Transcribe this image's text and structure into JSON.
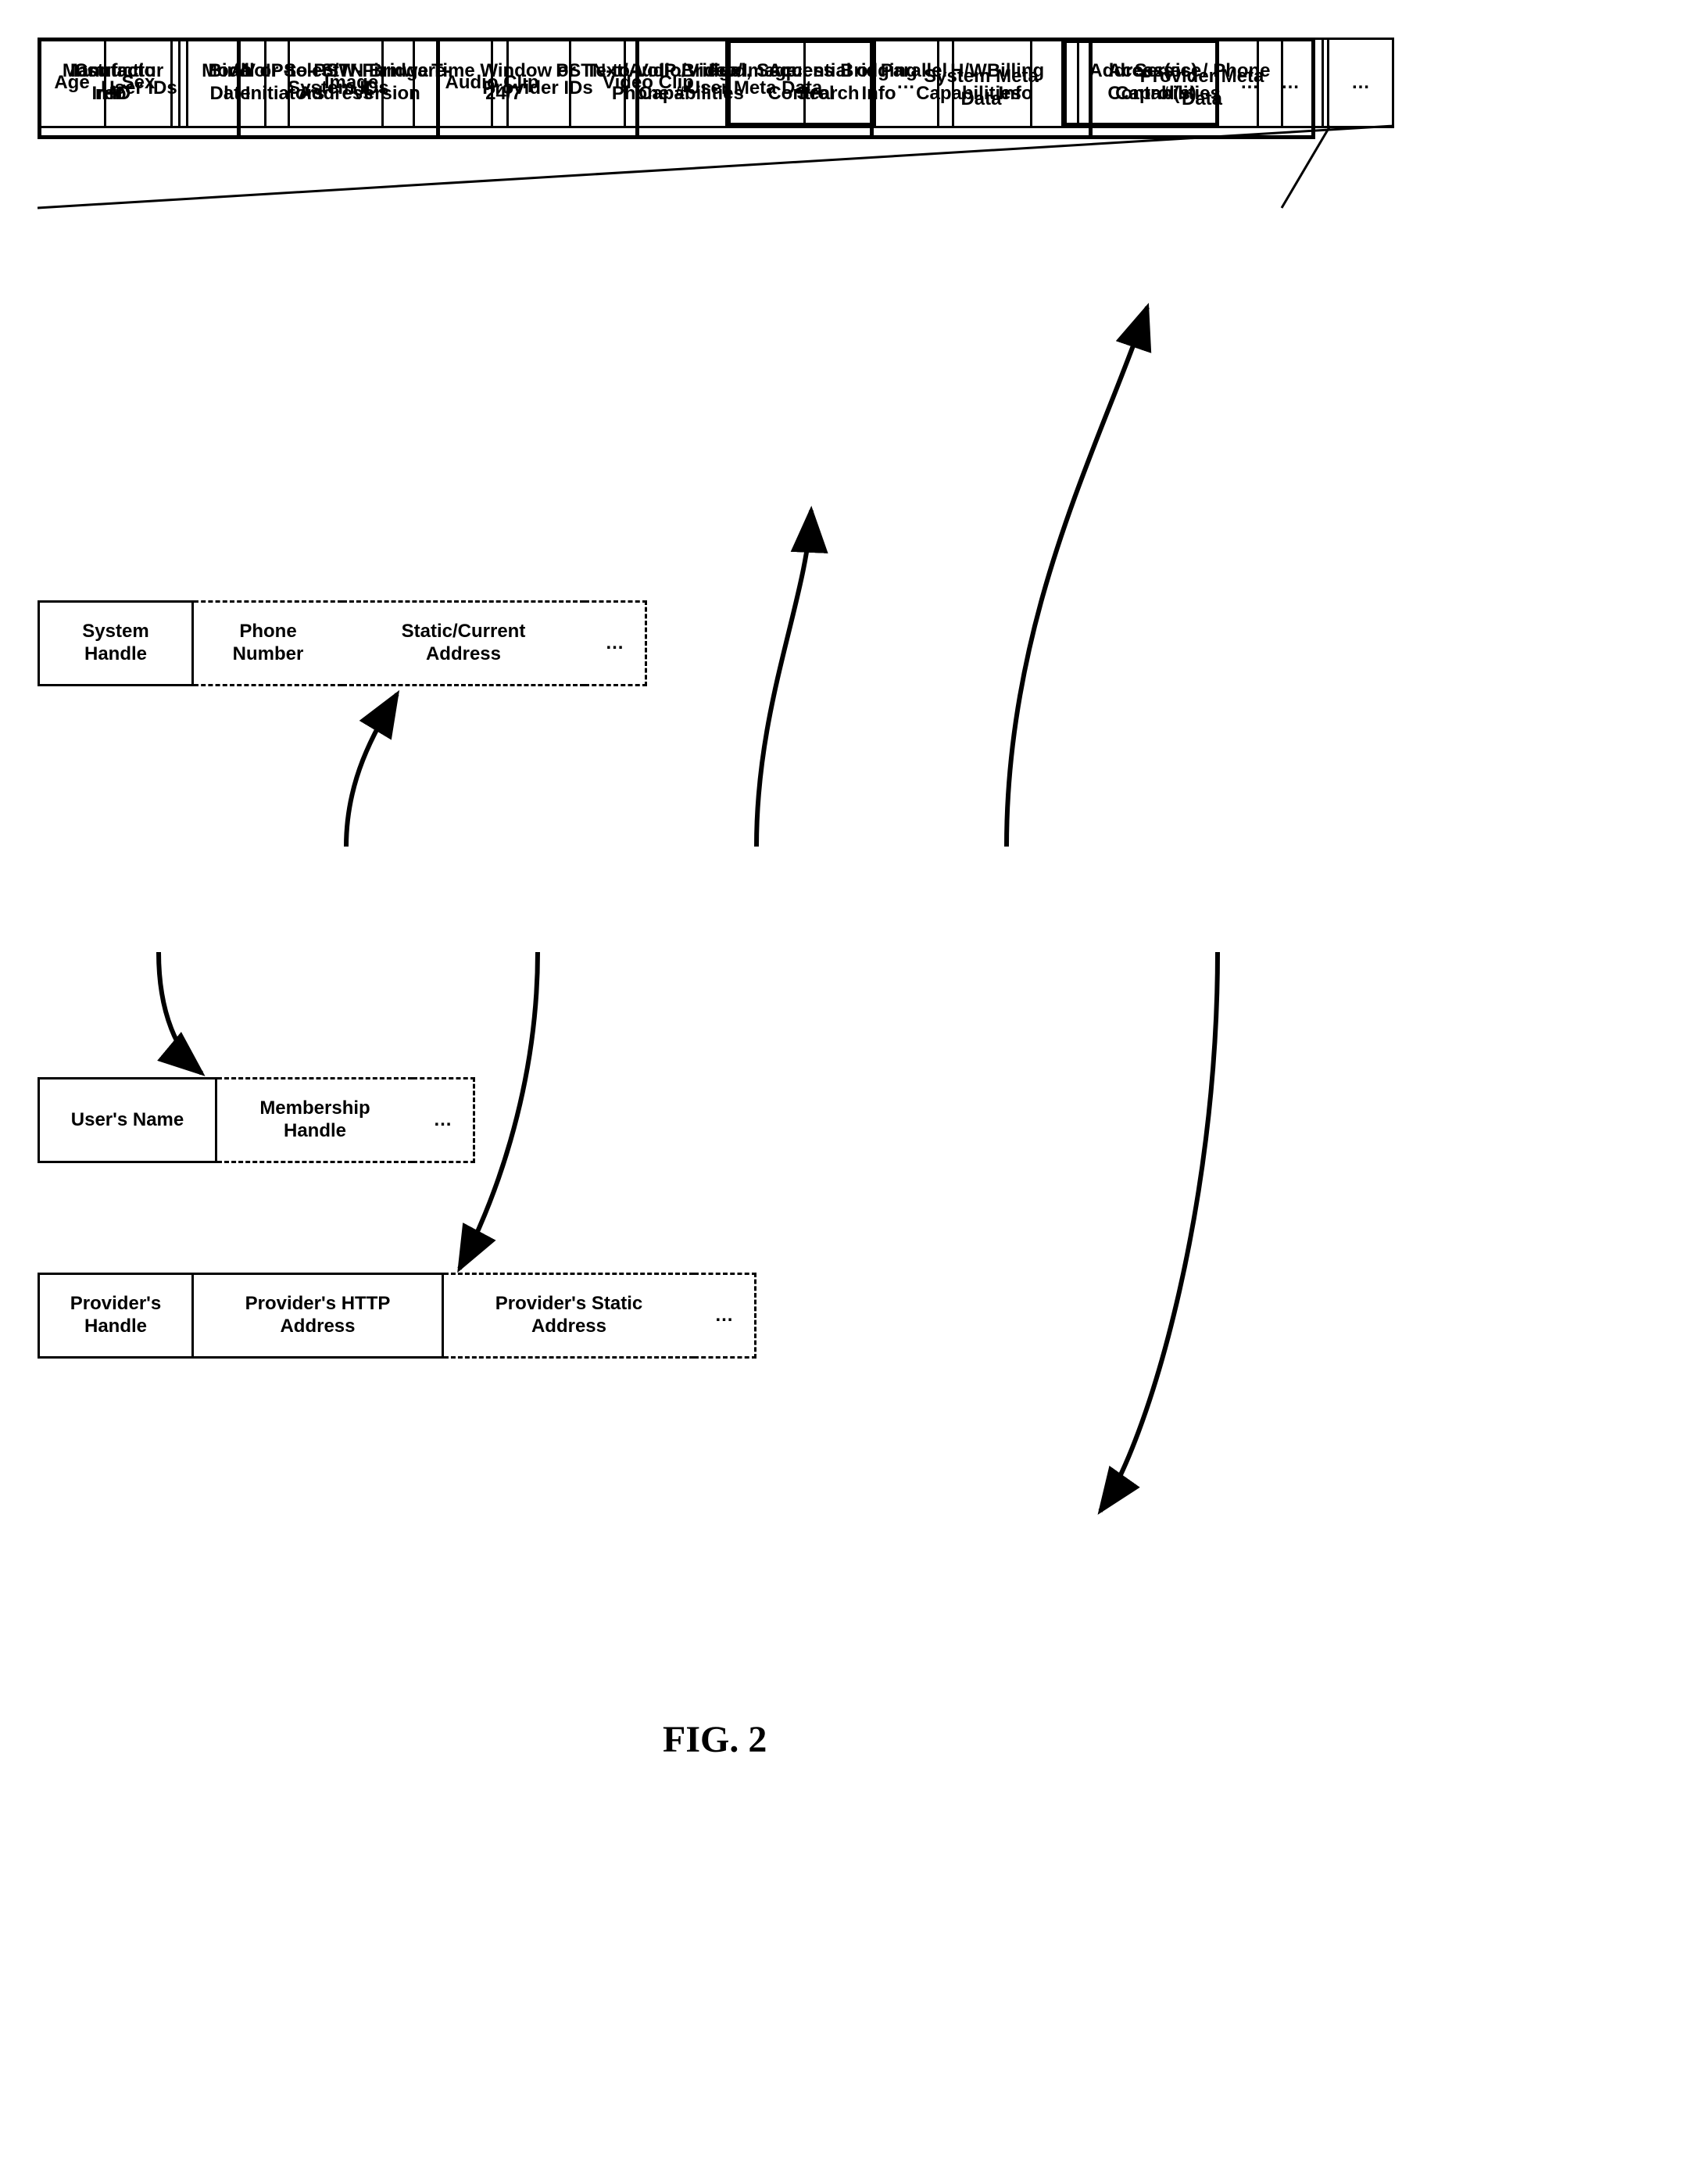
{
  "caption": "FIG. 2",
  "row1": {
    "c0": "Instructio\nn ID",
    "c1": "All or Select\nInitiators",
    "c2": "Time Window or\n24/7",
    "c3": "Fwd, Sequential or Parallel\nSearch",
    "c4": "Address(es) / Phone\n#(s)",
    "c5": "…"
  },
  "row2": {
    "c0": "Manufactur\ner",
    "c1": "Mode\nl",
    "c2": "S/W-Firmware-\nVersion",
    "c3": "Text/Audio/Video/Image\nCapabilities",
    "c4": "H/W\nCapabilities",
    "c5": "Access\nControl",
    "c6": "…"
  },
  "row3": {
    "c0": "Age",
    "c1": "Sex",
    "c2": "Birth\nDate",
    "c3": "Image",
    "c4": "Audio Clip",
    "c5": "Video Clip",
    "c6": "Access\nControl",
    "c7": "…"
  },
  "row4": {
    "c0": "System\nHandle",
    "c1": "Phone\nNumber",
    "c2": "Static/Current\nAddress",
    "c3": "…"
  },
  "row5": {
    "c0": "User IDs",
    "c1": "System IDs",
    "c2": "Provider IDs",
    "c3": "User Meta Data",
    "c4": "System Meta\nData",
    "c5": "Provider Meta\nData"
  },
  "row6": {
    "c0": "User's Name",
    "c1": "Membership\nHandle",
    "c2": "…"
  },
  "row7": {
    "c0": "Provider's\nHandle",
    "c1": "Provider's HTTP\nAddress",
    "c2": "Provider's Static\nAddress",
    "c3": "…"
  },
  "row8": {
    "c0": "Contact\nInfo",
    "c1": "VoIP-to-PSTN Bridge\nAddress",
    "c2": "PSTN-to-VoIP Bridge\nPhone #",
    "c3": "Bridging\nInfo",
    "c4": "Billing\nInfo",
    "c5": "Service\nCapabilities",
    "c6": "…"
  }
}
